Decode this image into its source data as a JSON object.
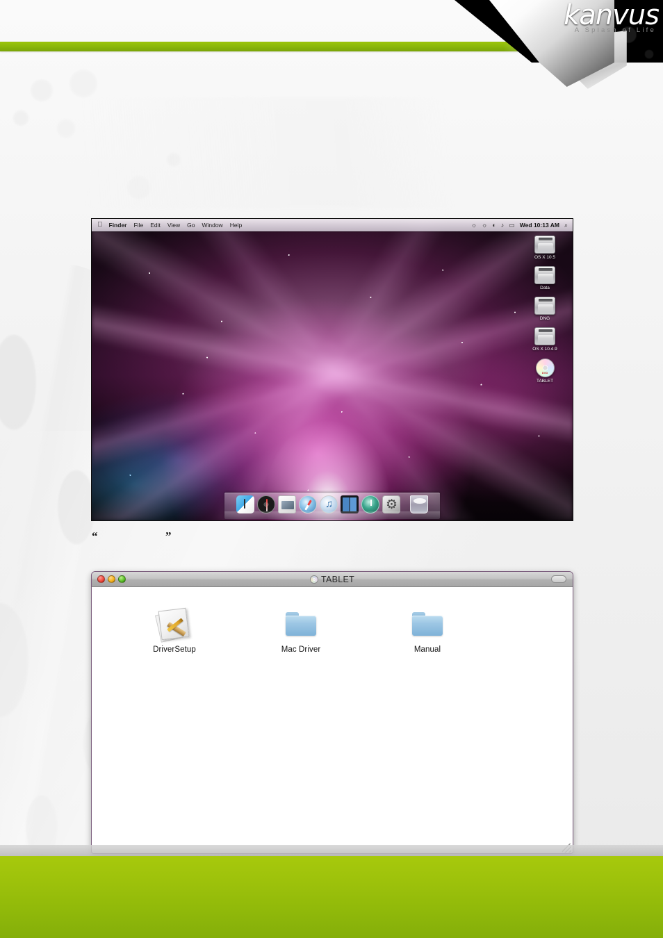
{
  "branding": {
    "name": "kanvus",
    "tagline": "A Splash of Life",
    "green": "#8cb909",
    "footer_green": "#9cc10b"
  },
  "quote": {
    "open": "“",
    "close": "”"
  },
  "desktop": {
    "menubar": {
      "apple": "",
      "items": [
        {
          "label": "Finder",
          "bold": true
        },
        {
          "label": "File",
          "bold": false
        },
        {
          "label": "Edit",
          "bold": false
        },
        {
          "label": "View",
          "bold": false
        },
        {
          "label": "Go",
          "bold": false
        },
        {
          "label": "Window",
          "bold": false
        },
        {
          "label": "Help",
          "bold": false
        }
      ],
      "status_icons": [
        {
          "name": "time-machine-icon",
          "glyph": "◴"
        },
        {
          "name": "bluetooth-icon",
          "glyph": "Ƀ"
        },
        {
          "name": "wifi-icon",
          "glyph": "◔"
        },
        {
          "name": "volume-icon",
          "glyph": "◀"
        },
        {
          "name": "input-source-icon",
          "glyph": "▭"
        }
      ],
      "clock": "Wed 10:13 AM",
      "search_icon": "⌕"
    },
    "icons": [
      {
        "name": "OS X 10.5",
        "type": "hard-drive"
      },
      {
        "name": "Data",
        "type": "hard-drive"
      },
      {
        "name": "DNG",
        "type": "hard-drive"
      },
      {
        "name": "OS X 10.4.9",
        "type": "hard-drive"
      },
      {
        "name": "TABLET",
        "type": "optical-disc"
      }
    ],
    "dock": [
      {
        "name": "Finder",
        "icon": "finder-icon"
      },
      {
        "name": "Dashboard",
        "icon": "dashboard-icon"
      },
      {
        "name": "Mail",
        "icon": "mail-icon"
      },
      {
        "name": "Safari",
        "icon": "safari-icon"
      },
      {
        "name": "iTunes",
        "icon": "itunes-icon"
      },
      {
        "name": "Spaces",
        "icon": "spaces-icon"
      },
      {
        "name": "Time Machine",
        "icon": "time-machine-icon"
      },
      {
        "name": "System Preferences",
        "icon": "system-preferences-icon"
      },
      {
        "name": "Trash",
        "icon": "trash-icon"
      }
    ]
  },
  "finder_window": {
    "title": "TABLET",
    "traffic_lights": [
      "close",
      "minimize",
      "zoom"
    ],
    "items": [
      {
        "label": "DriverSetup",
        "type": "installer-package"
      },
      {
        "label": "Mac Driver",
        "type": "folder"
      },
      {
        "label": "Manual",
        "type": "folder"
      }
    ]
  }
}
